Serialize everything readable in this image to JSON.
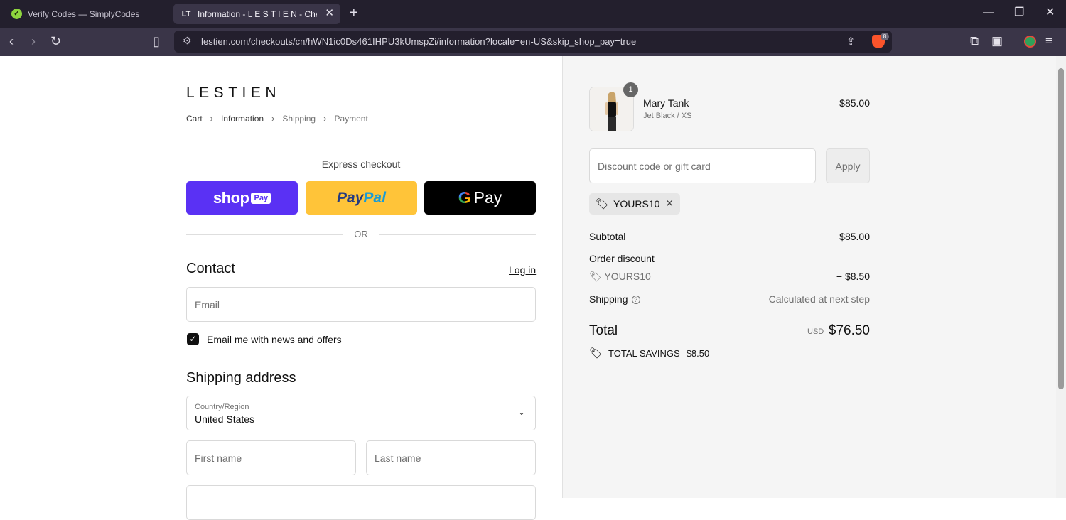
{
  "browser": {
    "tabs": [
      {
        "title": "Verify Codes — SimplyCodes",
        "favicon": "simplycodes-icon"
      },
      {
        "title": "Information - L E S T I E N - Checkout",
        "favicon": "LT"
      }
    ],
    "url": "lestien.com/checkouts/cn/hWN1ic0Ds461IHPU3kUmspZi/information?locale=en-US&skip_shop_pay=true",
    "shield_count": "8"
  },
  "checkout": {
    "brand": "LESTIEN",
    "breadcrumb": [
      "Cart",
      "Information",
      "Shipping",
      "Payment"
    ],
    "express_title": "Express checkout",
    "shoppay": {
      "text": "shop",
      "badge": "Pay"
    },
    "paypal": {
      "text_a": "Pay",
      "text_b": "Pal"
    },
    "gpay": {
      "g": "G",
      "text": "Pay"
    },
    "or": "OR",
    "contact": {
      "title": "Contact",
      "login": "Log in",
      "email_placeholder": "Email",
      "newsletter": "Email me with news and offers"
    },
    "shipping": {
      "title": "Shipping address",
      "country_label": "Country/Region",
      "country_value": "United States",
      "first_name": "First name",
      "last_name": "Last name"
    }
  },
  "summary": {
    "item": {
      "name": "Mary Tank",
      "variant": "Jet Black / XS",
      "price": "$85.00",
      "qty": "1"
    },
    "discount_placeholder": "Discount code or gift card",
    "apply": "Apply",
    "code": "YOURS10",
    "subtotal_label": "Subtotal",
    "subtotal_value": "$85.00",
    "order_discount_label": "Order discount",
    "discount_code": "YOURS10",
    "discount_value": "− $8.50",
    "shipping_label": "Shipping",
    "shipping_value": "Calculated at next step",
    "total_label": "Total",
    "currency": "USD",
    "total_value": "$76.50",
    "savings_label": "TOTAL SAVINGS",
    "savings_value": "$8.50"
  },
  "colors": {
    "shoppay": "#5a31f4",
    "paypal": "#ffc439",
    "gpay": "#000000"
  }
}
